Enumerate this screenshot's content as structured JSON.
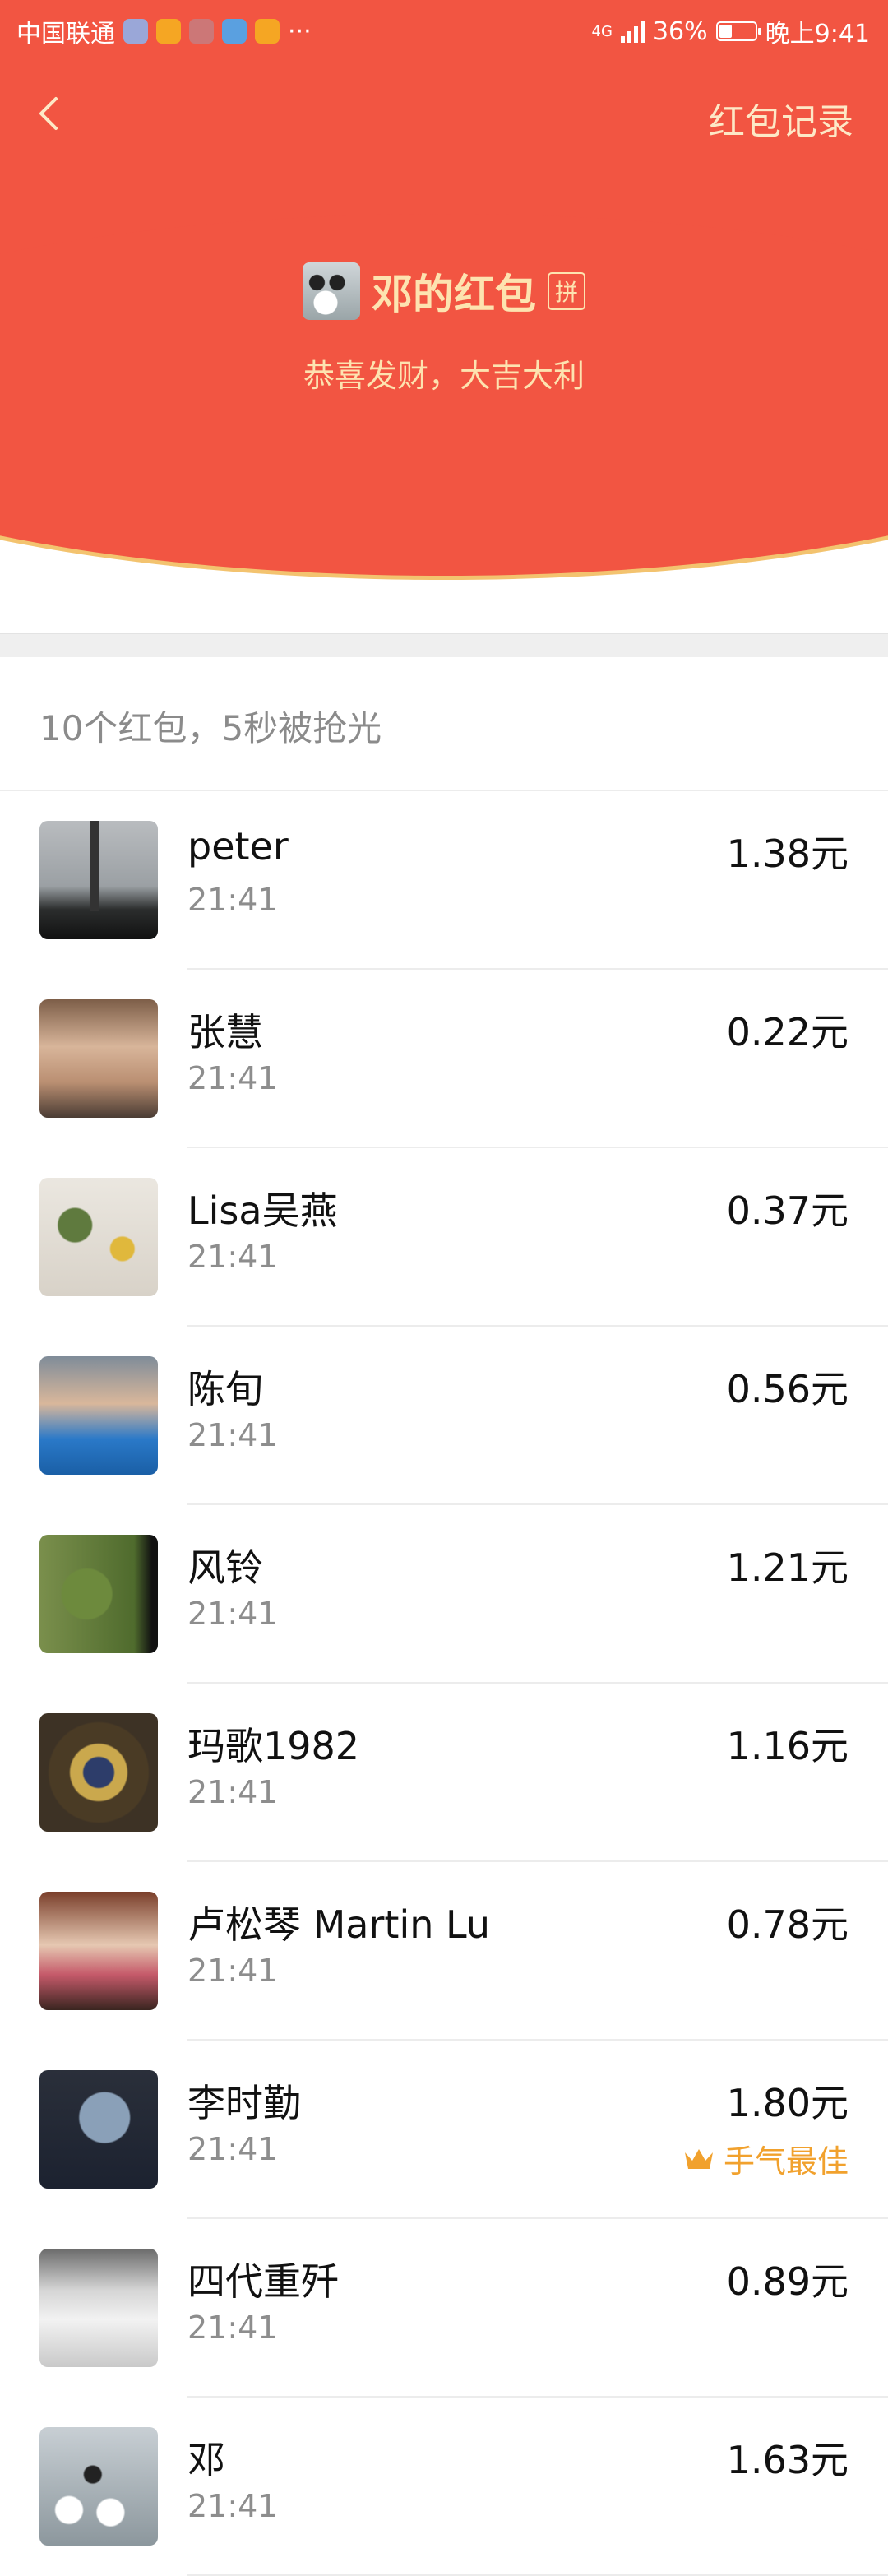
{
  "status_bar": {
    "carrier": "中国联通",
    "network": "4G",
    "battery_percent": "36%",
    "battery_level": 0.36,
    "time": "晚上9:41",
    "more": "···"
  },
  "nav": {
    "records_label": "红包记录"
  },
  "sender": {
    "name": "邓的红包",
    "pin_label": "拼",
    "greeting": "恭喜发财，大吉大利"
  },
  "summary": "10个红包，5秒被抢光",
  "entries": [
    {
      "name": "peter",
      "time": "21:41",
      "amount": "1.38元"
    },
    {
      "name": "张慧",
      "time": "21:41",
      "amount": "0.22元"
    },
    {
      "name": "Lisa吴燕",
      "time": "21:41",
      "amount": "0.37元"
    },
    {
      "name": "陈旬",
      "time": "21:41",
      "amount": "0.56元"
    },
    {
      "name": "风铃",
      "time": "21:41",
      "amount": "1.21元"
    },
    {
      "name": "玛歌1982",
      "time": "21:41",
      "amount": "1.16元"
    },
    {
      "name": "卢松琴 Martin Lu",
      "time": "21:41",
      "amount": "0.78元"
    },
    {
      "name": "李时勤",
      "time": "21:41",
      "amount": "1.80元",
      "best_label": "手气最佳"
    },
    {
      "name": "四代重歼",
      "time": "21:41",
      "amount": "0.89元"
    },
    {
      "name": "邓",
      "time": "21:41",
      "amount": "1.63元"
    }
  ],
  "colors": {
    "header_red": "#f25542",
    "header_text": "#fde3b0",
    "best_gold": "#f1a12d"
  }
}
